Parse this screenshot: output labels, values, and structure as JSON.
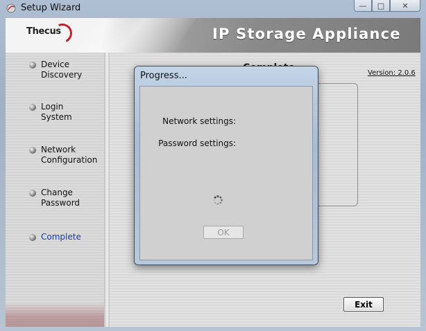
{
  "window": {
    "title": "Setup Wizard",
    "app_icon": "app-icon"
  },
  "controls": {
    "minimize": "—",
    "maximize": "□",
    "close": "✕"
  },
  "banner": {
    "logo": "Thecus",
    "product": "IP Storage Appliance"
  },
  "sidebar": {
    "steps": [
      {
        "label": "Device Discovery",
        "lines": [
          "Device",
          "Discovery"
        ]
      },
      {
        "label": "Login System",
        "lines": [
          "Login",
          "System"
        ]
      },
      {
        "label": "Network Configuration",
        "lines": [
          "Network",
          "Configuration"
        ]
      },
      {
        "label": "Change Password",
        "lines": [
          "Change",
          "Password"
        ]
      },
      {
        "label": "Complete",
        "lines": [
          "Complete"
        ],
        "active": true
      }
    ]
  },
  "main": {
    "page_title": "Complete",
    "version": "Version: 2.0.6",
    "exit_label": "Exit"
  },
  "dialog": {
    "title": "Progress...",
    "network_label": "Network settings:",
    "password_label": "Password settings:",
    "ok_label": "OK",
    "ok_disabled": true
  },
  "colors": {
    "active_step": "#1a3aa8",
    "logo_red": "#c0212b"
  }
}
